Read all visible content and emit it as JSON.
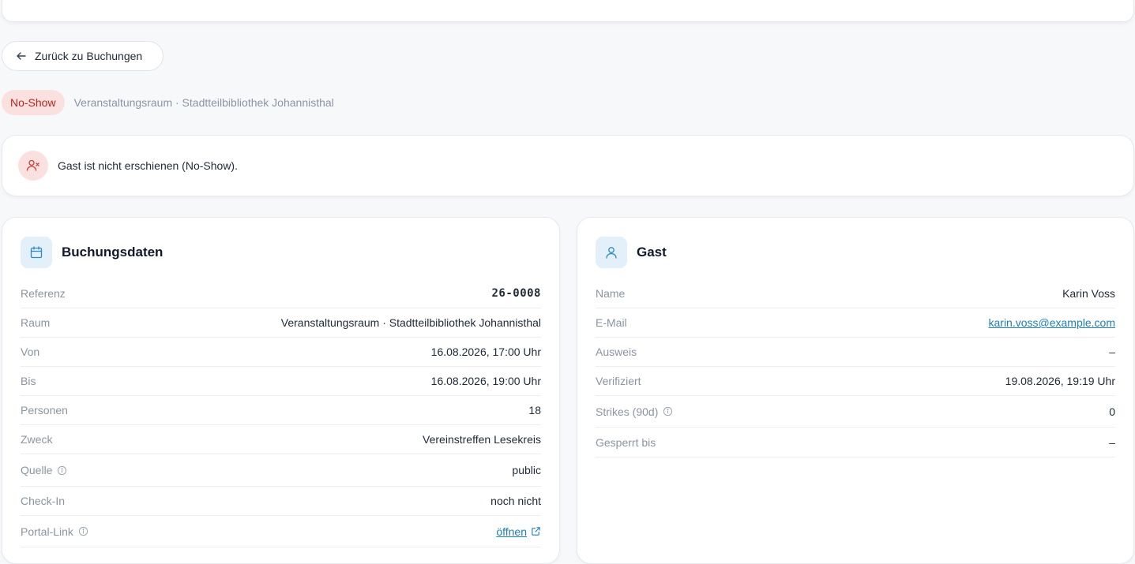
{
  "nav": {
    "back_label": "Zurück zu Buchungen"
  },
  "status": {
    "badge": "No-Show",
    "subtitle": "Veranstaltungsraum · Stadtteilbibliothek Johannisthal",
    "badge_color": "#b3261e",
    "badge_bg": "#fbe0e0"
  },
  "alert": {
    "text": "Gast ist nicht erschienen (No-Show).",
    "icon": "user-x-icon"
  },
  "booking": {
    "title": "Buchungsdaten",
    "icon": "calendar-icon",
    "rows": [
      {
        "label": "Referenz",
        "value": "26-0008"
      },
      {
        "label": "Raum",
        "value": "Veranstaltungsraum · Stadtteilbibliothek Johannisthal"
      },
      {
        "label": "Von",
        "value": "16.08.2026, 17:00 Uhr"
      },
      {
        "label": "Bis",
        "value": "16.08.2026, 19:00 Uhr"
      },
      {
        "label": "Personen",
        "value": "18"
      },
      {
        "label": "Zweck",
        "value": "Vereinstreffen Lesekreis"
      },
      {
        "label": "Quelle",
        "value": "public"
      },
      {
        "label": "Check-In",
        "value": "noch nicht"
      },
      {
        "label": "Portal-Link",
        "value": "öffnen"
      }
    ]
  },
  "guest": {
    "title": "Gast",
    "icon": "user-icon",
    "rows": [
      {
        "label": "Name",
        "value": "Karin Voss"
      },
      {
        "label": "E-Mail",
        "value": "karin.voss@example.com"
      },
      {
        "label": "Ausweis",
        "value": "–"
      },
      {
        "label": "Verifiziert",
        "value": "19.08.2026, 19:19 Uhr"
      },
      {
        "label": "Strikes (90d)",
        "value": "0"
      },
      {
        "label": "Gesperrt bis",
        "value": "–"
      }
    ]
  },
  "colors": {
    "accent": "#1e7fb8",
    "danger": "#b3261e",
    "icon_bg": "#e3f0fa"
  }
}
